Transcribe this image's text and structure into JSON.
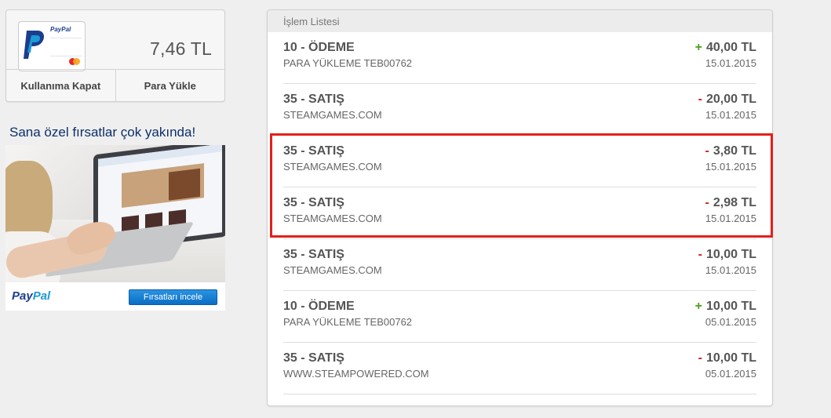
{
  "balance_card": {
    "card_logo_text": "PayPal",
    "balance": "7,46 TL",
    "actions": [
      {
        "label": "Kullanıma Kapat"
      },
      {
        "label": "Para Yükle"
      }
    ]
  },
  "promo": {
    "title": "Sana özel fırsatlar çok yakında!",
    "logo_pay": "Pay",
    "logo_pal": "Pal",
    "button_label": "Fırsatları incele"
  },
  "transactions": {
    "header": "İşlem Listesi",
    "items": [
      {
        "title": "10 - ÖDEME",
        "description": "PARA YÜKLEME TEB00762",
        "sign": "+",
        "amount": "40,00 TL",
        "date": "15.01.2015"
      },
      {
        "title": "35 - SATIŞ",
        "description": "STEAMGAMES.COM",
        "sign": "-",
        "amount": "20,00 TL",
        "date": "15.01.2015"
      },
      {
        "title": "35 - SATIŞ",
        "description": "STEAMGAMES.COM",
        "sign": "-",
        "amount": "3,80 TL",
        "date": "15.01.2015"
      },
      {
        "title": "35 - SATIŞ",
        "description": "STEAMGAMES.COM",
        "sign": "-",
        "amount": "2,98 TL",
        "date": "15.01.2015"
      },
      {
        "title": "35 - SATIŞ",
        "description": "STEAMGAMES.COM",
        "sign": "-",
        "amount": "10,00 TL",
        "date": "15.01.2015"
      },
      {
        "title": "10 - ÖDEME",
        "description": "PARA YÜKLEME TEB00762",
        "sign": "+",
        "amount": "10,00 TL",
        "date": "05.01.2015"
      },
      {
        "title": "35 - SATIŞ",
        "description": "WWW.STEAMPOWERED.COM",
        "sign": "-",
        "amount": "10,00 TL",
        "date": "05.01.2015"
      }
    ]
  },
  "colors": {
    "positive": "#4aa01f",
    "negative": "#c8261f",
    "highlight": "#e3201b",
    "brand_dark": "#1a3e8c",
    "brand_light": "#1c9ad6"
  },
  "icons": {
    "card": "paypal-card-icon",
    "mastercard": "mastercard-icon"
  }
}
